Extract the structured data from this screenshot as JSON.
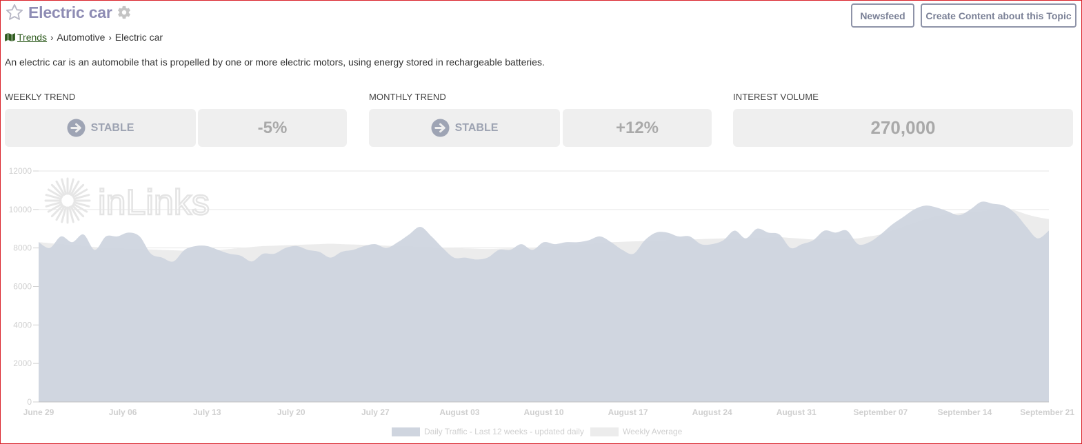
{
  "page": {
    "title": "Electric car",
    "description": "An electric car is an automobile that is propelled by one or more electric motors, using energy stored in rechargeable batteries."
  },
  "header": {
    "newsfeed_label": "Newsfeed",
    "create_label": "Create Content about this Topic"
  },
  "breadcrumb": {
    "items": [
      "Trends",
      "Automotive",
      "Electric car"
    ]
  },
  "stats": {
    "weekly": {
      "label": "WEEKLY TREND",
      "status": "STABLE",
      "change": "-5%"
    },
    "monthly": {
      "label": "MONTHLY TREND",
      "status": "STABLE",
      "change": "+12%"
    },
    "volume": {
      "label": "INTEREST VOLUME",
      "value": "270,000"
    }
  },
  "watermark": {
    "text": "inLinks"
  },
  "colors": {
    "title": "#8e8cb4",
    "daily_fill": "#cfd5df",
    "weekly_fill": "#ececec",
    "status_icon": "#9ea4b4",
    "box_bg": "#efefef"
  },
  "icons": [
    "star-icon",
    "gear-icon",
    "map-icon",
    "chevron-right-icon",
    "arrow-right-circle-icon"
  ],
  "chart_data": {
    "type": "area",
    "ylim": [
      0,
      12000
    ],
    "yticks": [
      0,
      2000,
      4000,
      6000,
      8000,
      10000,
      12000
    ],
    "x_labels": [
      "June 29",
      "July 06",
      "July 13",
      "July 20",
      "July 27",
      "August 03",
      "August 10",
      "August 17",
      "August 24",
      "August 31",
      "September 07",
      "September 14",
      "September 21"
    ],
    "grid": true,
    "legend_position": "bottom",
    "series": [
      {
        "name": "Daily Traffic - Last 12 weeks - updated daily",
        "values": [
          8300,
          8000,
          8600,
          8300,
          8700,
          7900,
          8600,
          8600,
          8800,
          8600,
          7700,
          7500,
          7300,
          7900,
          8100,
          8100,
          7900,
          7700,
          7600,
          7300,
          7700,
          7700,
          8000,
          8100,
          7900,
          7800,
          7500,
          7800,
          7900,
          8100,
          8200,
          8000,
          8300,
          8700,
          9100,
          8600,
          8000,
          7500,
          7500,
          7400,
          7500,
          7900,
          7900,
          8200,
          7900,
          8300,
          8200,
          8300,
          8300,
          8400,
          8600,
          8300,
          7900,
          7700,
          8400,
          8800,
          8800,
          8600,
          8600,
          8200,
          8200,
          8400,
          8900,
          8500,
          9000,
          8800,
          8700,
          8000,
          8200,
          8400,
          8900,
          8800,
          8900,
          8200,
          8300,
          8700,
          9200,
          9600,
          10000,
          10200,
          10100,
          9900,
          9700,
          10000,
          10400,
          10300,
          10200,
          9800,
          9100,
          8500,
          8900
        ]
      },
      {
        "name": "Weekly Average",
        "values": [
          8300,
          8250,
          8200,
          8150,
          8100,
          8050,
          8000,
          7980,
          7960,
          7940,
          7920,
          7900,
          7880,
          7860,
          7870,
          7880,
          7900,
          7950,
          8000,
          8050,
          8100,
          8120,
          8140,
          8160,
          8180,
          8200,
          8220,
          8200,
          8180,
          8160,
          8140,
          8120,
          8100,
          8080,
          8060,
          8040,
          8020,
          8000,
          7980,
          7960,
          7950,
          7960,
          7980,
          8000,
          8020,
          8050,
          8080,
          8100,
          8150,
          8200,
          8250,
          8300,
          8320,
          8340,
          8360,
          8380,
          8400,
          8420,
          8440,
          8460,
          8480,
          8500,
          8500,
          8500,
          8520,
          8540,
          8560,
          8520,
          8480,
          8440,
          8440,
          8460,
          8480,
          8500,
          8600,
          8700,
          8900,
          9100,
          9300,
          9500,
          9650,
          9750,
          9800,
          9850,
          9900,
          10000,
          10100,
          9950,
          9750,
          9600,
          9500
        ]
      }
    ]
  }
}
